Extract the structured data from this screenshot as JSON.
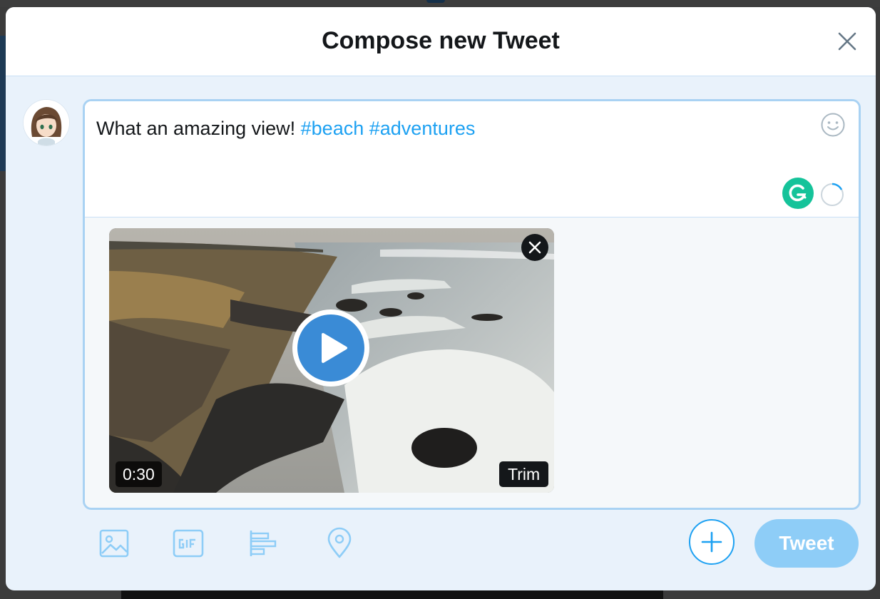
{
  "modal": {
    "title": "Compose new Tweet",
    "close_icon": "close-icon"
  },
  "composer": {
    "text_plain": "What an amazing view!",
    "hashtags": [
      "#beach",
      "#adventures"
    ],
    "emoji_icon": "smiley-icon",
    "grammarly_icon": "grammarly-icon",
    "char_counter": "progress-ring-icon"
  },
  "media": {
    "type": "video",
    "duration": "0:30",
    "trim_label": "Trim",
    "play_icon": "play-icon",
    "remove_icon": "close-icon"
  },
  "toolbar": {
    "icons": [
      "image-icon",
      "gif-icon",
      "poll-icon",
      "location-icon"
    ],
    "add_icon": "plus-icon",
    "tweet_label": "Tweet"
  },
  "colors": {
    "accent": "#1da1f2",
    "tweet_button_disabled": "#8ecdf7",
    "modal_background": "#e9f2fb",
    "grammarly": "#15c39a"
  }
}
